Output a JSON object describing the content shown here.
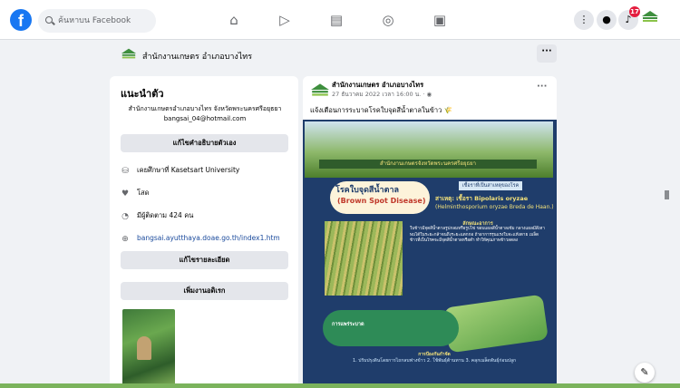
{
  "topnav": {
    "logo": "f",
    "search_placeholder": "ค้นหาบน Facebook",
    "nav_icons": [
      "home-icon",
      "video-icon",
      "marketplace-icon",
      "groups-icon",
      "gaming-icon"
    ],
    "right_icons": [
      "menu-grid-icon",
      "messenger-icon",
      "bell-icon",
      "profile-avatar"
    ],
    "notification_count": "17"
  },
  "subheader": {
    "page_title": "สำนักงานเกษตร อำเภอบางไทร",
    "more": "···"
  },
  "intro": {
    "heading": "แนะนำตัว",
    "bio": "สำนักงานเกษตรอำเภอบางไทร จังหวัดพระนครศรีอยุธยา bangsai_04@hotmail.com",
    "edit_bio_button": "แก้ไขคำอธิบายตัวเอง",
    "info": [
      {
        "icon": "graduation-cap-icon",
        "text": "เคยศึกษาที่ Kasetsart University"
      },
      {
        "icon": "heart-icon",
        "text": "โสด"
      },
      {
        "icon": "rss-icon",
        "text": "มีผู้ติดตาม 424 คน"
      },
      {
        "icon": "globe-icon",
        "text": "bangsai.ayutthaya.doae.go.th/index1.htm"
      }
    ],
    "edit_details_button": "แก้ไขรายละเอียด",
    "add_featured_button": "เพิ่มงานอดิเรก"
  },
  "post": {
    "author": "สำนักงานเกษตร อำเภอบางไทร",
    "meta": "27 ธันวาคม 2022 เวลา 16:00 น. · ",
    "more": "···",
    "text": "แจ้งเตือนการระบาดโรคใบจุดสีน้ำตาลในข้าว 🌾",
    "poster": {
      "header_band": "สำนักงานเกษตรจังหวัดพระนครศรีอยุธยา",
      "title_th": "โรคใบจุดสีน้ำตาล",
      "title_en": "(Brown Spot Disease)",
      "tag": "เชื้อราที่เป็นสาเหตุของโรค",
      "cause": "สาเหตุ: เชื้อรา Bipolaris oryzae",
      "cause_alt": "(Helminthosporium oryzae Breda de Haan.)",
      "symptoms_heading": "ลักษณะอาการ",
      "symptoms": "ใบข้าวมีจุดสีน้ำตาลรูปกลมหรือรูปไข่ ขอบแผลสีน้ำตาลเข้ม กลางแผลมีสีเทา พบได้ในระยะกล้าจนถึงระยะแตกกอ ถ้าอาการรุนแรงใบจะแห้งตาย เมล็ดข้าวที่เป็นโรคจะมีจุดสีน้ำตาลหรือดำ ทำให้คุณภาพข้าวลดลง",
      "spread_label": "การแพร่ระบาด",
      "prevention_heading": "การป้องกันกำจัด",
      "prevention": "1. ปรับปรุงดินโดยการไถกลบฟางข้าว 2. ใช้พันธุ์ต้านทาน 3. คลุกเมล็ดพันธุ์ก่อนปลูก"
    }
  },
  "colors": {
    "facebook_blue": "#1877f2",
    "background": "#f0f2f5",
    "button_gray": "#e4e6eb",
    "badge_red": "#e41e3f"
  }
}
